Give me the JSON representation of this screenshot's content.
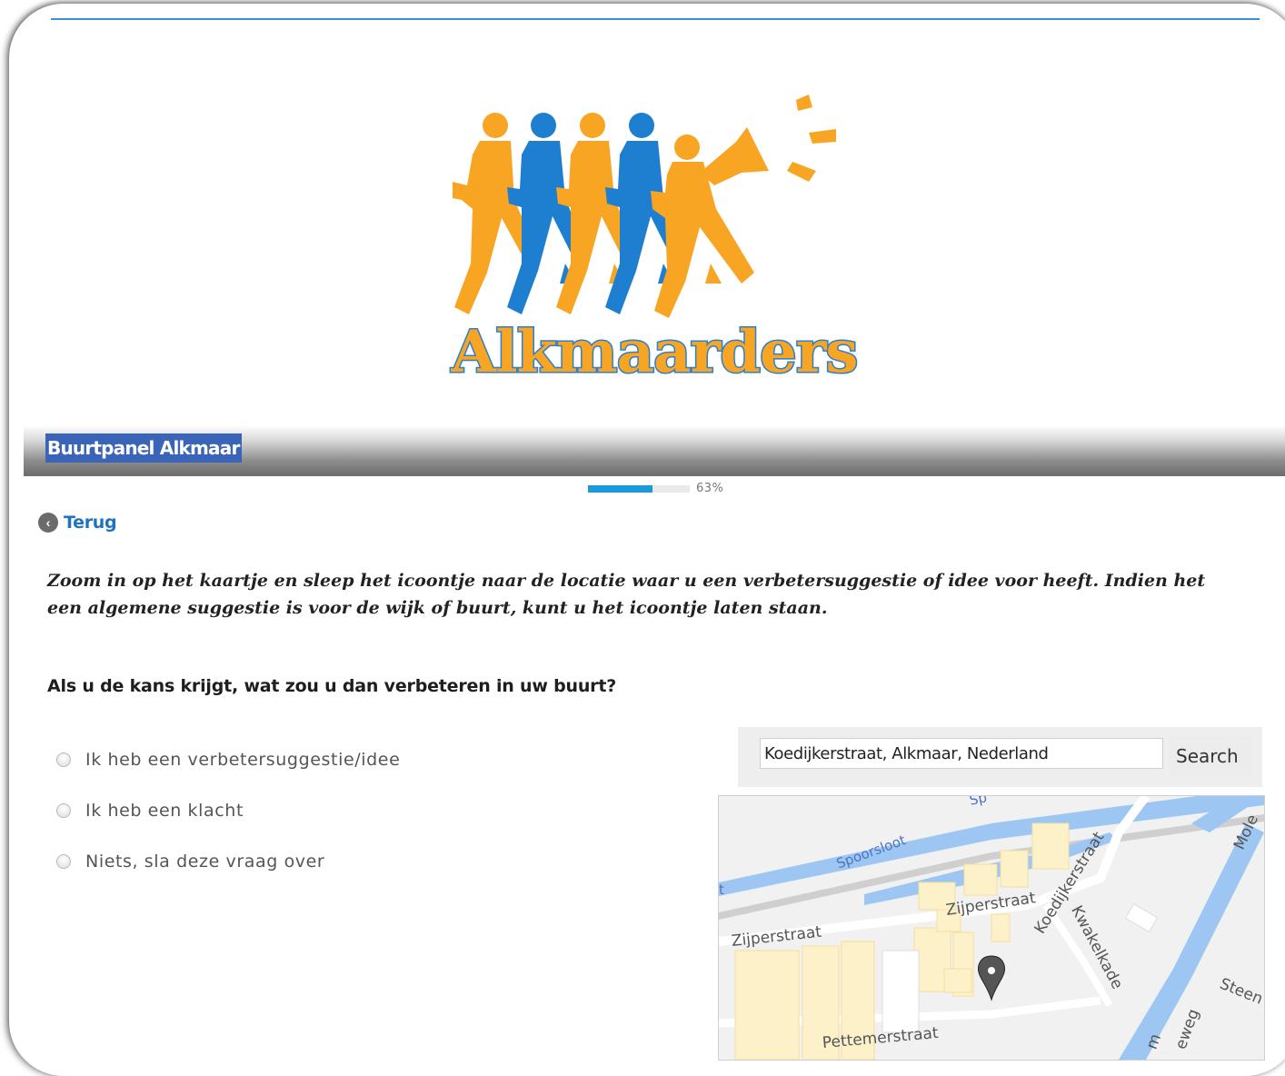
{
  "header": {
    "logo_text": "Alkmaarders",
    "banner_title": "Buurtpanel Alkmaar"
  },
  "progress": {
    "value": 0.63,
    "label": "63%"
  },
  "nav": {
    "back_label": "Terug"
  },
  "instruction": "Zoom in op het kaartje en sleep het icoontje naar de locatie waar u een verbetersuggestie of idee voor heeft. Indien het een algemene suggestie is voor de wijk of buurt, kunt u het icoontje laten staan.",
  "question": {
    "title": "Als u de kans krijgt, wat zou u dan verbeteren in uw buurt?",
    "options": [
      "Ik heb een verbetersuggestie/idee",
      "Ik heb een klacht",
      "Niets, sla deze vraag over"
    ]
  },
  "map_search": {
    "value": "Koedijkerstraat, Alkmaar, Nederland",
    "button_label": "Search"
  },
  "map": {
    "streets": {
      "spoorsloot": "Spoorsloot",
      "zijperstraat_left": "Zijperstraat",
      "zijperstraat_right": "Zijperstraat",
      "koedijkerstraat": "Koedijkerstraat",
      "kwakelkade": "Kwakelkade",
      "oudorpweg": "Steen",
      "mole": "Mole",
      "pettemerstraat": "Pettemerstraat",
      "eweg": "eweg",
      "sp": "Sp",
      "m": "m",
      "t": "t"
    },
    "colors": {
      "water": "#9dc7f2",
      "building": "#fdf1c9",
      "pin": "#555555"
    },
    "pin_icon": "map-marker-icon"
  },
  "colors": {
    "accent_blue": "#1e73be",
    "logo_orange": "#f7a522",
    "logo_blue": "#2a7fd0",
    "banner_title_bg": "#3a64b8"
  }
}
